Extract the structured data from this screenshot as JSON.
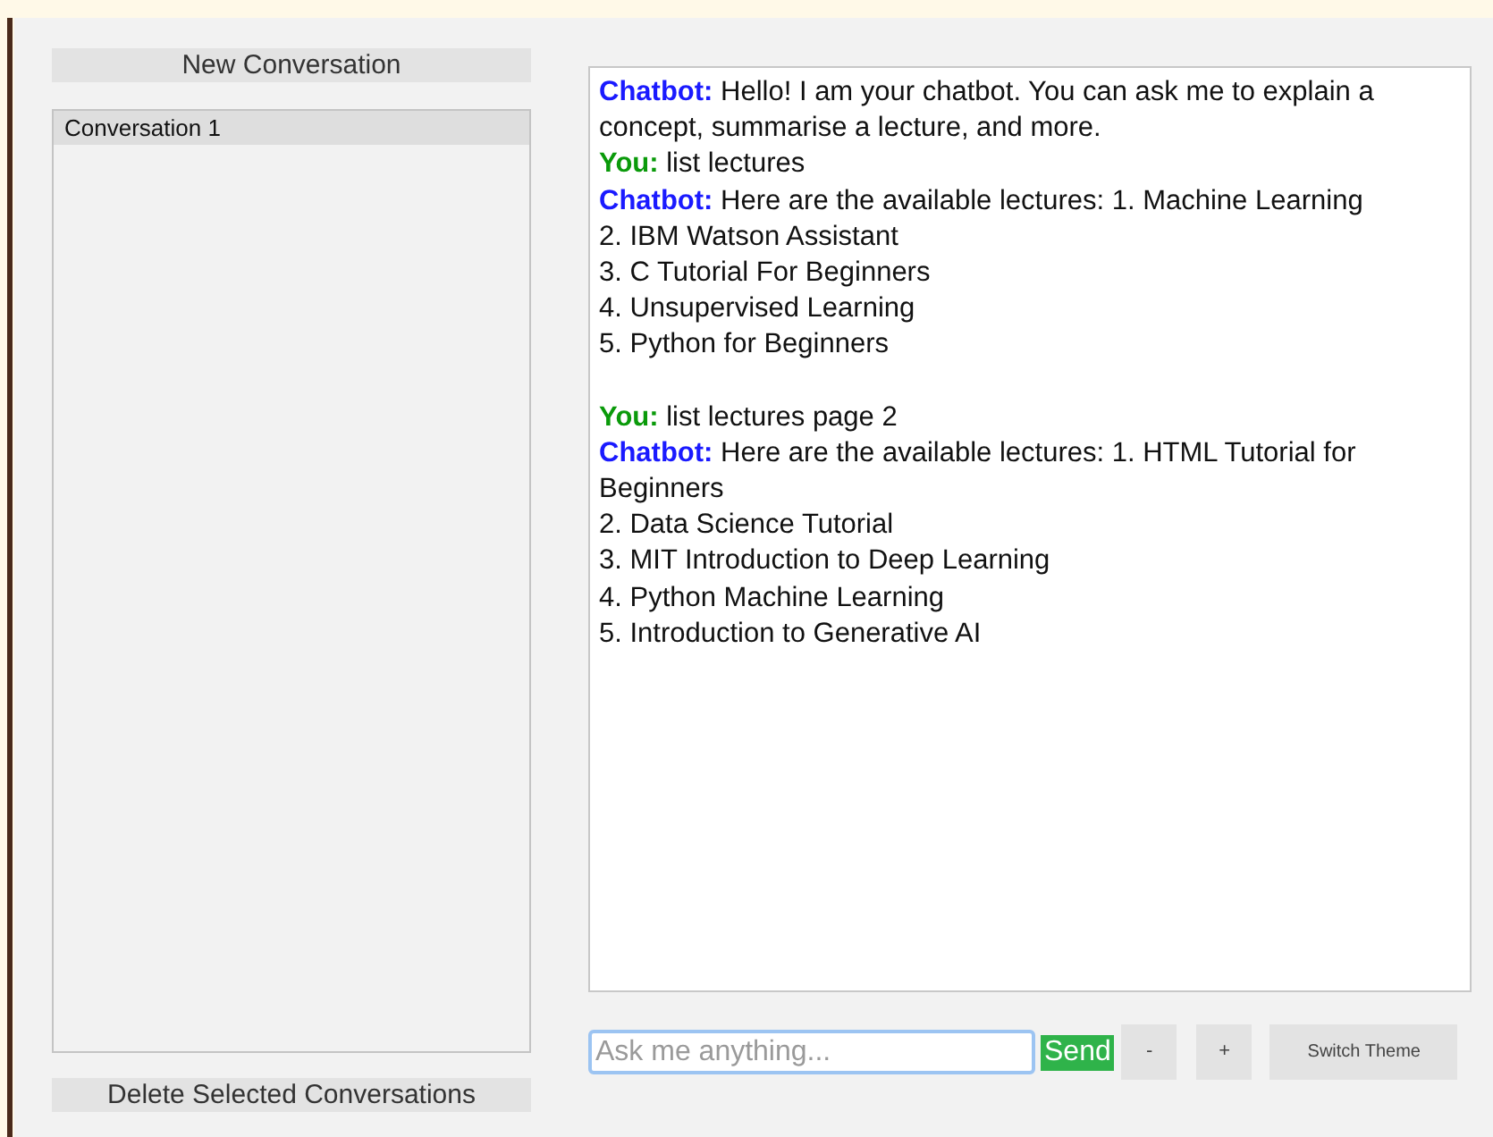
{
  "sidebar": {
    "new_button": "New Conversation",
    "conversations": [
      {
        "label": "Conversation 1",
        "selected": true
      }
    ],
    "delete_button": "Delete Selected Conversations"
  },
  "chat": {
    "messages": [
      {
        "kind": "bot",
        "speaker": "Chatbot:",
        "text": "Hello! I am your chatbot. You can ask me to explain a concept, summarise a lecture, and more.",
        "gap_after": false
      },
      {
        "kind": "user",
        "speaker": "You:",
        "text": "list lectures",
        "gap_after": false
      },
      {
        "kind": "bot",
        "speaker": "Chatbot:",
        "text": "Here are the available lectures: 1. Machine Learning\n2. IBM Watson Assistant\n3. C Tutorial For Beginners\n4. Unsupervised Learning\n5. Python for Beginners",
        "gap_after": true
      },
      {
        "kind": "user",
        "speaker": "You:",
        "text": "list lectures page 2",
        "gap_after": false
      },
      {
        "kind": "bot",
        "speaker": "Chatbot:",
        "text": "Here are the available lectures: 1. HTML Tutorial for Beginners\n2. Data Science Tutorial\n3. MIT Introduction to Deep Learning\n4. Python Machine Learning\n5. Introduction to Generative AI",
        "gap_after": false
      }
    ]
  },
  "input": {
    "placeholder": "Ask me anything..."
  },
  "buttons": {
    "send": "Send",
    "decrease": "-",
    "increase": "+",
    "theme": "Switch Theme"
  }
}
